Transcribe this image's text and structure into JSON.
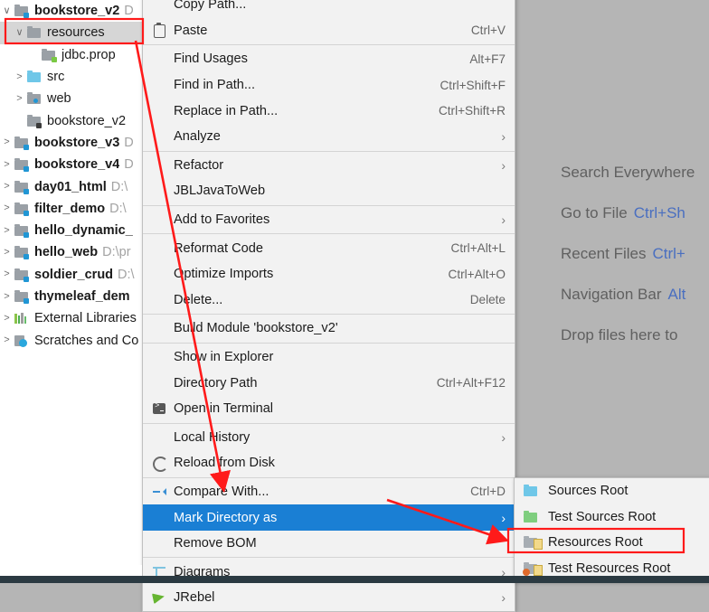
{
  "colors": {
    "background": "#b5b5b5",
    "menu_bg": "#f2f2f2",
    "menu_highlight": "#1a7fd4",
    "annotation_red": "#ff1a1a",
    "tree_selection": "#d6d6d6",
    "hint_key": "#4a6fc0",
    "hint_text": "#606060"
  },
  "project_tree": {
    "items": [
      {
        "twisty": "v",
        "indent": 0,
        "icon": "module-folder-icon",
        "label": "bookstore_v2",
        "bold": true,
        "path": "D",
        "selected": false
      },
      {
        "twisty": "v",
        "indent": 1,
        "icon": "folder-icon",
        "label": "resources",
        "bold": false,
        "path": "",
        "selected": true
      },
      {
        "twisty": "",
        "indent": 2,
        "icon": "properties-file-icon",
        "label": "jdbc.prop",
        "bold": false,
        "path": "",
        "selected": false
      },
      {
        "twisty": ">",
        "indent": 1,
        "icon": "sources-folder-icon",
        "label": "src",
        "bold": false,
        "path": "",
        "selected": false
      },
      {
        "twisty": ">",
        "indent": 1,
        "icon": "web-folder-icon",
        "label": "web",
        "bold": false,
        "path": "",
        "selected": false
      },
      {
        "twisty": "",
        "indent": 1,
        "icon": "module-file-icon",
        "label": "bookstore_v2",
        "bold": false,
        "path": "",
        "selected": false
      },
      {
        "twisty": ">",
        "indent": 0,
        "icon": "module-folder-icon",
        "label": "bookstore_v3",
        "bold": true,
        "path": "D",
        "selected": false
      },
      {
        "twisty": ">",
        "indent": 0,
        "icon": "module-folder-icon",
        "label": "bookstore_v4",
        "bold": true,
        "path": "D",
        "selected": false
      },
      {
        "twisty": ">",
        "indent": 0,
        "icon": "module-folder-icon",
        "label": "day01_html",
        "bold": true,
        "path": "D:\\",
        "selected": false
      },
      {
        "twisty": ">",
        "indent": 0,
        "icon": "module-folder-icon",
        "label": "filter_demo",
        "bold": true,
        "path": "D:\\",
        "selected": false
      },
      {
        "twisty": ">",
        "indent": 0,
        "icon": "module-folder-icon",
        "label": "hello_dynamic_",
        "bold": true,
        "path": "",
        "selected": false
      },
      {
        "twisty": ">",
        "indent": 0,
        "icon": "module-folder-icon",
        "label": "hello_web",
        "bold": true,
        "path": "D:\\pr",
        "selected": false
      },
      {
        "twisty": ">",
        "indent": 0,
        "icon": "module-folder-icon",
        "label": "soldier_crud",
        "bold": true,
        "path": "D:\\",
        "selected": false
      },
      {
        "twisty": ">",
        "indent": 0,
        "icon": "module-folder-icon",
        "label": "thymeleaf_dem",
        "bold": true,
        "path": "",
        "selected": false
      },
      {
        "twisty": ">",
        "indent": 0,
        "icon": "external-libraries-icon",
        "label": "External Libraries",
        "bold": false,
        "path": "",
        "selected": false
      },
      {
        "twisty": ">",
        "indent": 0,
        "icon": "scratches-icon",
        "label": "Scratches and Co",
        "bold": false,
        "path": "",
        "selected": false
      }
    ]
  },
  "context_menu": {
    "items": [
      {
        "type": "item",
        "icon": "",
        "label": "Copy Path...",
        "shortcut": "",
        "arrow": false,
        "highlighted": false,
        "clipped": true
      },
      {
        "type": "item",
        "icon": "paste-icon",
        "label": "Paste",
        "shortcut": "Ctrl+V",
        "arrow": false,
        "highlighted": false
      },
      {
        "type": "separator"
      },
      {
        "type": "item",
        "icon": "",
        "label": "Find Usages",
        "shortcut": "Alt+F7",
        "arrow": false,
        "highlighted": false
      },
      {
        "type": "item",
        "icon": "",
        "label": "Find in Path...",
        "shortcut": "Ctrl+Shift+F",
        "arrow": false,
        "highlighted": false
      },
      {
        "type": "item",
        "icon": "",
        "label": "Replace in Path...",
        "shortcut": "Ctrl+Shift+R",
        "arrow": false,
        "highlighted": false
      },
      {
        "type": "item",
        "icon": "",
        "label": "Analyze",
        "shortcut": "",
        "arrow": true,
        "highlighted": false
      },
      {
        "type": "separator"
      },
      {
        "type": "item",
        "icon": "",
        "label": "Refactor",
        "shortcut": "",
        "arrow": true,
        "highlighted": false
      },
      {
        "type": "item",
        "icon": "",
        "label": "JBLJavaToWeb",
        "shortcut": "",
        "arrow": false,
        "highlighted": false
      },
      {
        "type": "separator"
      },
      {
        "type": "item",
        "icon": "",
        "label": "Add to Favorites",
        "shortcut": "",
        "arrow": true,
        "highlighted": false
      },
      {
        "type": "separator"
      },
      {
        "type": "item",
        "icon": "",
        "label": "Reformat Code",
        "shortcut": "Ctrl+Alt+L",
        "arrow": false,
        "highlighted": false
      },
      {
        "type": "item",
        "icon": "",
        "label": "Optimize Imports",
        "shortcut": "Ctrl+Alt+O",
        "arrow": false,
        "highlighted": false
      },
      {
        "type": "item",
        "icon": "",
        "label": "Delete...",
        "shortcut": "Delete",
        "arrow": false,
        "highlighted": false
      },
      {
        "type": "separator"
      },
      {
        "type": "item",
        "icon": "",
        "label": "Build Module 'bookstore_v2'",
        "shortcut": "",
        "arrow": false,
        "highlighted": false
      },
      {
        "type": "separator"
      },
      {
        "type": "item",
        "icon": "",
        "label": "Show in Explorer",
        "shortcut": "",
        "arrow": false,
        "highlighted": false
      },
      {
        "type": "item",
        "icon": "",
        "label": "Directory Path",
        "shortcut": "Ctrl+Alt+F12",
        "arrow": false,
        "highlighted": false
      },
      {
        "type": "item",
        "icon": "terminal-icon",
        "label": "Open in Terminal",
        "shortcut": "",
        "arrow": false,
        "highlighted": false
      },
      {
        "type": "separator"
      },
      {
        "type": "item",
        "icon": "",
        "label": "Local History",
        "shortcut": "",
        "arrow": true,
        "highlighted": false
      },
      {
        "type": "item",
        "icon": "reload-icon",
        "label": "Reload from Disk",
        "shortcut": "",
        "arrow": false,
        "highlighted": false
      },
      {
        "type": "separator"
      },
      {
        "type": "item",
        "icon": "compare-icon",
        "label": "Compare With...",
        "shortcut": "Ctrl+D",
        "arrow": false,
        "highlighted": false
      },
      {
        "type": "item",
        "icon": "",
        "label": "Mark Directory as",
        "shortcut": "",
        "arrow": true,
        "highlighted": true
      },
      {
        "type": "item",
        "icon": "",
        "label": "Remove BOM",
        "shortcut": "",
        "arrow": false,
        "highlighted": false
      },
      {
        "type": "separator"
      },
      {
        "type": "item",
        "icon": "diagrams-icon",
        "label": "Diagrams",
        "shortcut": "",
        "arrow": true,
        "highlighted": false
      },
      {
        "type": "item",
        "icon": "jrebel-icon",
        "label": "JRebel",
        "shortcut": "",
        "arrow": true,
        "highlighted": false
      }
    ]
  },
  "mark_directory_submenu": {
    "items": [
      {
        "icon": "sources-root-icon",
        "label": "Sources Root",
        "highlighted": false
      },
      {
        "icon": "test-sources-root-icon",
        "label": "Test Sources Root",
        "highlighted": false
      },
      {
        "icon": "resources-root-icon",
        "label": "Resources Root",
        "highlighted": false,
        "annotated": true
      },
      {
        "icon": "test-resources-root-icon",
        "label": "Test Resources Root",
        "highlighted": false
      }
    ]
  },
  "editor_hints": [
    {
      "text": "Search Everywhere",
      "key": ""
    },
    {
      "text": "Go to File",
      "key": "Ctrl+Sh"
    },
    {
      "text": "Recent Files",
      "key": "Ctrl+"
    },
    {
      "text": "Navigation Bar",
      "key": "Alt"
    },
    {
      "text": "Drop files here to",
      "key": ""
    }
  ]
}
